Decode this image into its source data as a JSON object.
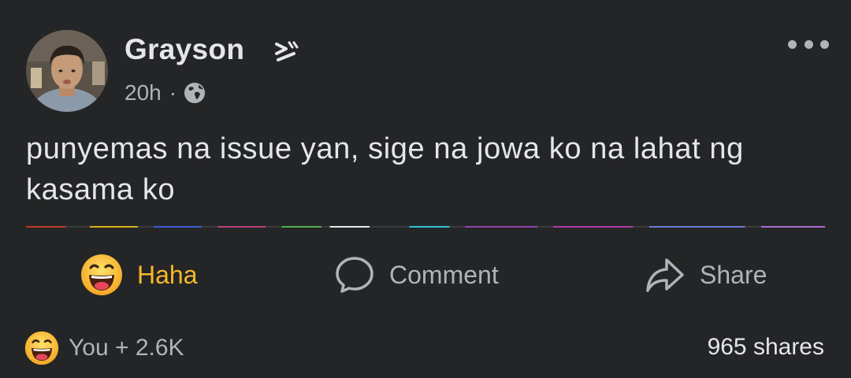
{
  "post": {
    "author": "Grayson",
    "time": "20h",
    "separator": "·",
    "audience_icon": "globe-icon",
    "badge_icon": "badge-icon",
    "text": "punyemas na issue yan, sige na jowa ko na lahat ng kasama ko"
  },
  "actions": {
    "reaction_label": "Haha",
    "reaction_icon": "haha-emoji-icon",
    "comment_label": "Comment",
    "comment_icon": "comment-bubble-icon",
    "share_label": "Share",
    "share_icon": "share-arrow-icon"
  },
  "footer": {
    "reaction_icon": "haha-emoji-icon",
    "reaction_count": "You + 2.6K",
    "shares": "965 shares"
  },
  "colors": {
    "background": "#242526",
    "primary_text": "#e4e6eb",
    "secondary_text": "#b0b3b8",
    "haha_accent": "#f7b928"
  }
}
